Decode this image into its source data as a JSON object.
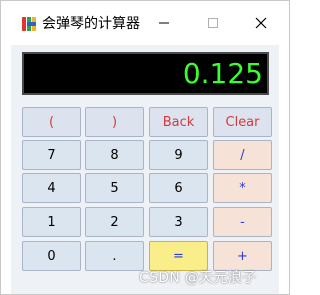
{
  "window": {
    "title": "会弹琴的计算器",
    "controls": {
      "minimize": "minimize",
      "maximize": "maximize",
      "close": "close"
    }
  },
  "display": {
    "value": "0.125"
  },
  "keys": {
    "row1": [
      "(",
      ")",
      "Back",
      "Clear"
    ],
    "row2": [
      "7",
      "8",
      "9",
      "/"
    ],
    "row3": [
      "4",
      "5",
      "6",
      "*"
    ],
    "row4": [
      "1",
      "2",
      "3",
      "-"
    ],
    "row5": [
      "0",
      ".",
      "=",
      "+"
    ]
  },
  "watermark": "CSDN @天元浪子",
  "colors": {
    "display_bg": "#000000",
    "display_text": "#39ff2e",
    "top_key_text": "#d23b3b",
    "operator_key_bg": "#f7e2d8",
    "operator_text": "#2b3bd9",
    "equals_key_bg": "#f9ee89",
    "number_key_bg": "#dbe5f0"
  }
}
